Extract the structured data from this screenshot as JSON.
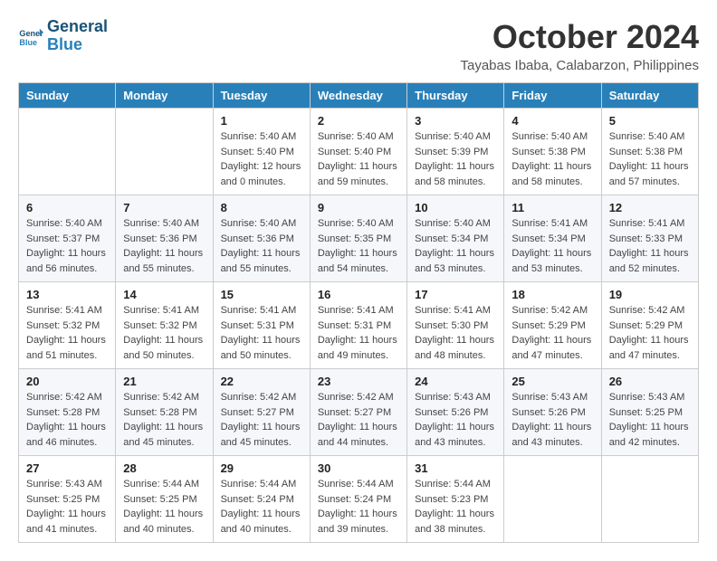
{
  "header": {
    "logo_line1": "General",
    "logo_line2": "Blue",
    "month": "October 2024",
    "location": "Tayabas Ibaba, Calabarzon, Philippines"
  },
  "weekdays": [
    "Sunday",
    "Monday",
    "Tuesday",
    "Wednesday",
    "Thursday",
    "Friday",
    "Saturday"
  ],
  "weeks": [
    [
      {
        "day": "",
        "info": ""
      },
      {
        "day": "",
        "info": ""
      },
      {
        "day": "1",
        "info": "Sunrise: 5:40 AM\nSunset: 5:40 PM\nDaylight: 12 hours and 0 minutes."
      },
      {
        "day": "2",
        "info": "Sunrise: 5:40 AM\nSunset: 5:40 PM\nDaylight: 11 hours and 59 minutes."
      },
      {
        "day": "3",
        "info": "Sunrise: 5:40 AM\nSunset: 5:39 PM\nDaylight: 11 hours and 58 minutes."
      },
      {
        "day": "4",
        "info": "Sunrise: 5:40 AM\nSunset: 5:38 PM\nDaylight: 11 hours and 58 minutes."
      },
      {
        "day": "5",
        "info": "Sunrise: 5:40 AM\nSunset: 5:38 PM\nDaylight: 11 hours and 57 minutes."
      }
    ],
    [
      {
        "day": "6",
        "info": "Sunrise: 5:40 AM\nSunset: 5:37 PM\nDaylight: 11 hours and 56 minutes."
      },
      {
        "day": "7",
        "info": "Sunrise: 5:40 AM\nSunset: 5:36 PM\nDaylight: 11 hours and 55 minutes."
      },
      {
        "day": "8",
        "info": "Sunrise: 5:40 AM\nSunset: 5:36 PM\nDaylight: 11 hours and 55 minutes."
      },
      {
        "day": "9",
        "info": "Sunrise: 5:40 AM\nSunset: 5:35 PM\nDaylight: 11 hours and 54 minutes."
      },
      {
        "day": "10",
        "info": "Sunrise: 5:40 AM\nSunset: 5:34 PM\nDaylight: 11 hours and 53 minutes."
      },
      {
        "day": "11",
        "info": "Sunrise: 5:41 AM\nSunset: 5:34 PM\nDaylight: 11 hours and 53 minutes."
      },
      {
        "day": "12",
        "info": "Sunrise: 5:41 AM\nSunset: 5:33 PM\nDaylight: 11 hours and 52 minutes."
      }
    ],
    [
      {
        "day": "13",
        "info": "Sunrise: 5:41 AM\nSunset: 5:32 PM\nDaylight: 11 hours and 51 minutes."
      },
      {
        "day": "14",
        "info": "Sunrise: 5:41 AM\nSunset: 5:32 PM\nDaylight: 11 hours and 50 minutes."
      },
      {
        "day": "15",
        "info": "Sunrise: 5:41 AM\nSunset: 5:31 PM\nDaylight: 11 hours and 50 minutes."
      },
      {
        "day": "16",
        "info": "Sunrise: 5:41 AM\nSunset: 5:31 PM\nDaylight: 11 hours and 49 minutes."
      },
      {
        "day": "17",
        "info": "Sunrise: 5:41 AM\nSunset: 5:30 PM\nDaylight: 11 hours and 48 minutes."
      },
      {
        "day": "18",
        "info": "Sunrise: 5:42 AM\nSunset: 5:29 PM\nDaylight: 11 hours and 47 minutes."
      },
      {
        "day": "19",
        "info": "Sunrise: 5:42 AM\nSunset: 5:29 PM\nDaylight: 11 hours and 47 minutes."
      }
    ],
    [
      {
        "day": "20",
        "info": "Sunrise: 5:42 AM\nSunset: 5:28 PM\nDaylight: 11 hours and 46 minutes."
      },
      {
        "day": "21",
        "info": "Sunrise: 5:42 AM\nSunset: 5:28 PM\nDaylight: 11 hours and 45 minutes."
      },
      {
        "day": "22",
        "info": "Sunrise: 5:42 AM\nSunset: 5:27 PM\nDaylight: 11 hours and 45 minutes."
      },
      {
        "day": "23",
        "info": "Sunrise: 5:42 AM\nSunset: 5:27 PM\nDaylight: 11 hours and 44 minutes."
      },
      {
        "day": "24",
        "info": "Sunrise: 5:43 AM\nSunset: 5:26 PM\nDaylight: 11 hours and 43 minutes."
      },
      {
        "day": "25",
        "info": "Sunrise: 5:43 AM\nSunset: 5:26 PM\nDaylight: 11 hours and 43 minutes."
      },
      {
        "day": "26",
        "info": "Sunrise: 5:43 AM\nSunset: 5:25 PM\nDaylight: 11 hours and 42 minutes."
      }
    ],
    [
      {
        "day": "27",
        "info": "Sunrise: 5:43 AM\nSunset: 5:25 PM\nDaylight: 11 hours and 41 minutes."
      },
      {
        "day": "28",
        "info": "Sunrise: 5:44 AM\nSunset: 5:25 PM\nDaylight: 11 hours and 40 minutes."
      },
      {
        "day": "29",
        "info": "Sunrise: 5:44 AM\nSunset: 5:24 PM\nDaylight: 11 hours and 40 minutes."
      },
      {
        "day": "30",
        "info": "Sunrise: 5:44 AM\nSunset: 5:24 PM\nDaylight: 11 hours and 39 minutes."
      },
      {
        "day": "31",
        "info": "Sunrise: 5:44 AM\nSunset: 5:23 PM\nDaylight: 11 hours and 38 minutes."
      },
      {
        "day": "",
        "info": ""
      },
      {
        "day": "",
        "info": ""
      }
    ]
  ]
}
